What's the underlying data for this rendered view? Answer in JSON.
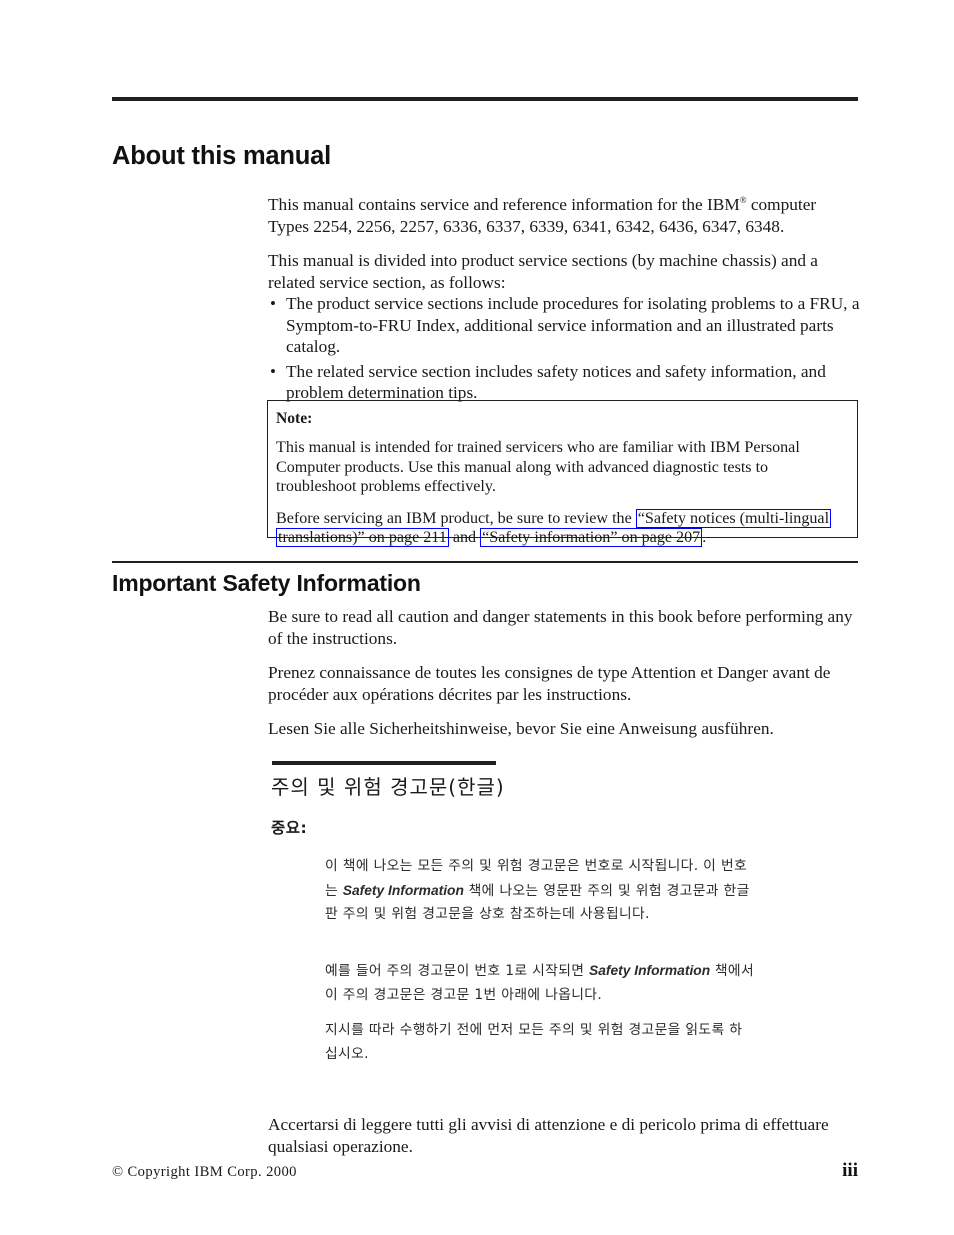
{
  "document": {
    "page_number": "iii",
    "copyright": "© Copyright IBM Corp. 2000",
    "link_color": "#0000ff",
    "rule_color": "#231f20"
  },
  "sections": {
    "about": {
      "heading": "About this manual",
      "intro_before_mark": "This manual contains service and reference information for the IBM",
      "registered_mark": "®",
      "intro_after_mark": " computer Types 2254, 2256, 2257, 6336, 6337, 6339, 6341, 6342, 6436, 6347, 6348.",
      "divided_paragraph": "This manual is divided into product service sections (by machine chassis) and a related service section, as follows:",
      "bullet_marker": "•",
      "bullets": [
        "The product service sections include procedures for isolating problems to a FRU, a Symptom-to-FRU Index, additional service information and an illustrated parts catalog.",
        "The related service section includes safety notices and safety information, and problem determination tips."
      ]
    },
    "note": {
      "label": "Note:",
      "paragraph_1": "This manual is intended for trained servicers who are familiar with IBM Personal Computer products. Use this manual along with advanced diagnostic tests to troubleshoot problems effectively.",
      "paragraph_2_prefix": "Before servicing an IBM product, be sure to review the ",
      "link_1": "“Safety notices (multi-lingual translations)” on page 211",
      "paragraph_2_middle": " and ",
      "link_2": "“Safety information” on page 207",
      "paragraph_2_suffix": "."
    },
    "safety": {
      "heading": "Important Safety Information",
      "english": "Be sure to read all caution and danger statements in this book before performing any of the instructions.",
      "french": "Prenez connaissance de toutes les consignes de type Attention et Danger avant de procéder aux opérations décrites par les instructions.",
      "german": "Lesen Sie alle Sicherheitshinweise, bevor Sie eine Anweisung ausführen.",
      "italian": "Accertarsi di leggere tutti gli avvisi di attenzione e di pericolo prima di effettuare qualsiasi operazione."
    },
    "korean": {
      "heading": "주의 및 위험 경고문(한글)",
      "important_label": "중요:",
      "paragraph_1_part1": "이 책에 나오는 모든 주의 및 위험 경고문은 번호로 시작됩니다. 이 번호는 ",
      "paragraph_1_italic": "Safety Information",
      "paragraph_1_part2": " 책에 나오는 영문판 주의 및 위험 경고문과 한글판 주의 및 위험 경고문을 상호 참조하는데 사용됩니다.",
      "paragraph_2_part1": "예를 들어 주의 경고문이 번호 1로 시작되면 ",
      "paragraph_2_italic": "Safety Information",
      "paragraph_2_part2": " 책에서 이 주의 경고문은 경고문 1번 아래에 나옵니다.",
      "paragraph_3": "지시를 따라 수행하기 전에 먼저 모든 주의 및 위험 경고문을 읽도록 하십시오."
    }
  }
}
